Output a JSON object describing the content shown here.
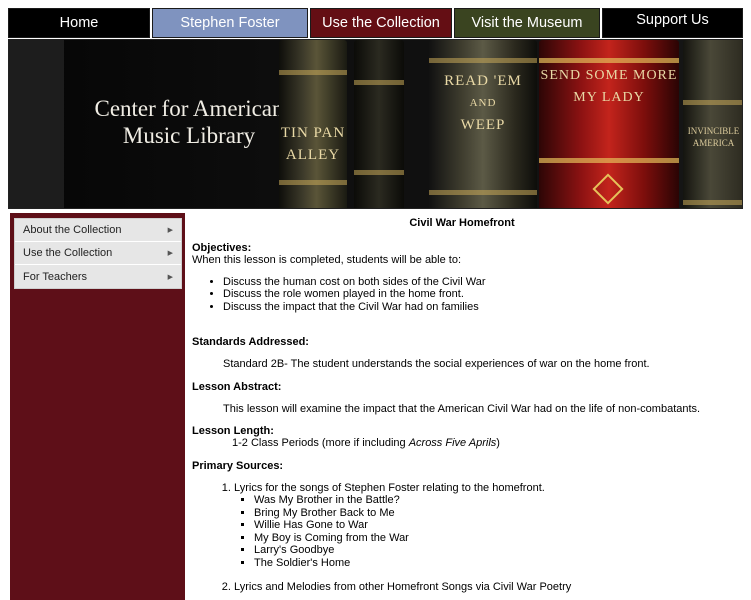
{
  "nav": {
    "home": "Home",
    "stephen_foster": "Stephen Foster",
    "use_collection": "Use the Collection",
    "visit_museum": "Visit the Museum",
    "support_us": "Support Us"
  },
  "banner": {
    "title_line1": "Center for American",
    "title_line2": "Music Library",
    "book1_line1": "TIN PAN",
    "book1_line2": "ALLEY",
    "book3_line1": "READ 'EM",
    "book3_line2": "AND",
    "book3_line3": "WEEP",
    "book4_line1": "SEND SOME MORE",
    "book4_line2": "MY LADY",
    "book5_line1": "INVINCIBLE",
    "book5_line2": "AMERICA"
  },
  "sidebar": {
    "items": [
      {
        "label": "About the Collection"
      },
      {
        "label": "Use the Collection"
      },
      {
        "label": "For Teachers"
      }
    ]
  },
  "lesson": {
    "title": "Civil War Homefront",
    "objectives_heading": "Objectives:",
    "objectives_intro": "When this lesson is completed, students will be able to:",
    "objectives": [
      "Discuss the human cost on both sides of the Civil War",
      "Discuss the role women played in the home front.",
      "Discuss the impact that the Civil War had on families"
    ],
    "standards_heading": "Standards Addressed:",
    "standards_text": "Standard 2B- The student understands the social experiences of war on the home front.",
    "abstract_heading": "Lesson Abstract:",
    "abstract_text": "This lesson will examine the impact that the American Civil War had on the life of non-combatants.",
    "length_heading": "Lesson Length:",
    "length_text_pre": "1-2 Class Periods (more if including ",
    "length_text_italic": "Across Five Aprils",
    "length_text_post": ")",
    "sources_heading": "Primary Sources:",
    "sources": [
      {
        "label": "Lyrics for the songs of Stephen Foster relating to the homefront.",
        "songs": [
          "Was My Brother in the Battle?",
          "Bring My Brother Back to Me",
          "Willie Has Gone to War",
          "My Boy is Coming from the War",
          "Larry's Goodbye",
          "The Soldier's Home"
        ]
      },
      {
        "label": "Lyrics and Melodies from other Homefront Songs via Civil War Poetry"
      }
    ]
  }
}
